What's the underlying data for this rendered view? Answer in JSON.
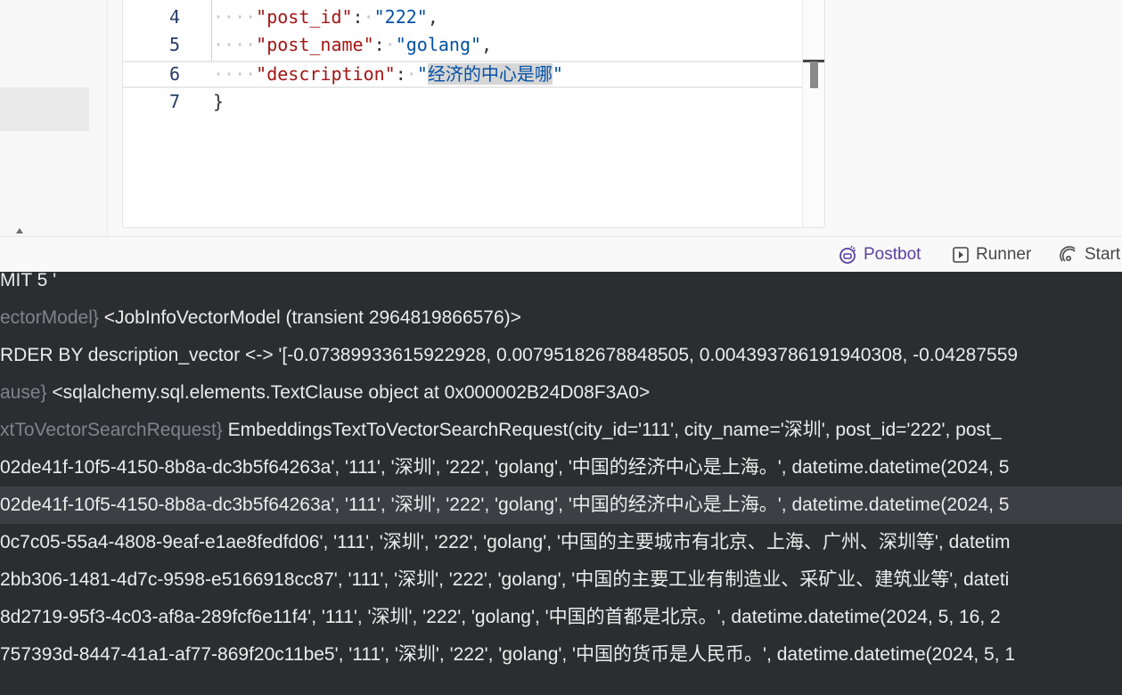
{
  "editor": {
    "lines": [
      {
        "num": "4",
        "key": "\"post_id\"",
        "colon": ":",
        "value": "\"222\"",
        "tail": ","
      },
      {
        "num": "5",
        "key": "\"post_name\"",
        "colon": ":",
        "value": "\"golang\"",
        "tail": ","
      },
      {
        "num": "6",
        "key": "\"description\"",
        "colon": ":",
        "quote_open": "\"",
        "selected_value": "经济的中心是哪",
        "quote_close": "\""
      },
      {
        "num": "7",
        "brace": "}"
      }
    ]
  },
  "statusbar": {
    "postbot": "Postbot",
    "runner": "Runner",
    "start": "Start"
  },
  "console": {
    "rows": [
      {
        "prefix": "",
        "text": "MIT 5 '"
      },
      {
        "prefix": "ectorModel}",
        "text": " <JobInfoVectorModel (transient 2964819866576)>"
      },
      {
        "prefix": "",
        "text": "RDER BY description_vector <-> '[-0.07389933615922928, 0.00795182678848505, 0.004393786191940308, -0.04287559"
      },
      {
        "prefix": "ause}",
        "text": " <sqlalchemy.sql.elements.TextClause object at 0x000002B24D08F3A0>"
      },
      {
        "prefix": "xtToVectorSearchRequest}",
        "text": " EmbeddingsTextToVectorSearchRequest(city_id='111', city_name='深圳', post_id='222', post_"
      },
      {
        "prefix": "",
        "text": "02de41f-10f5-4150-8b8a-dc3b5f64263a', '111', '深圳', '222', 'golang', '中国的经济中心是上海。', datetime.datetime(2024, 5"
      },
      {
        "prefix": "",
        "text": "02de41f-10f5-4150-8b8a-dc3b5f64263a', '111', '深圳', '222', 'golang', '中国的经济中心是上海。', datetime.datetime(2024, 5"
      },
      {
        "prefix": "",
        "text": "0c7c05-55a4-4808-9eaf-e1ae8fedfd06', '111', '深圳', '222', 'golang', '中国的主要城市有北京、上海、广州、深圳等', datetim"
      },
      {
        "prefix": "",
        "text": "2bb306-1481-4d7c-9598-e5166918cc87', '111', '深圳', '222', 'golang', '中国的主要工业有制造业、采矿业、建筑业等', dateti"
      },
      {
        "prefix": "",
        "text": "8d2719-95f3-4c03-af8a-289fcf6e11f4', '111', '深圳', '222', 'golang', '中国的首都是北京。', datetime.datetime(2024, 5, 16, 2"
      },
      {
        "prefix": "",
        "text": "757393d-8447-41a1-af77-869f20c11be5', '111', '深圳', '222', 'golang', '中国的货币是人民币。', datetime.datetime(2024, 5, 1"
      }
    ],
    "highlighted_row": 6
  },
  "icons": {
    "postbot": "postbot-icon",
    "runner": "runner-icon",
    "start": "start-icon"
  },
  "colors": {
    "console_bg": "#2b2d30",
    "json_key": "#a31515",
    "json_string": "#0451a5",
    "postbot_accent": "#5a3fa0"
  }
}
